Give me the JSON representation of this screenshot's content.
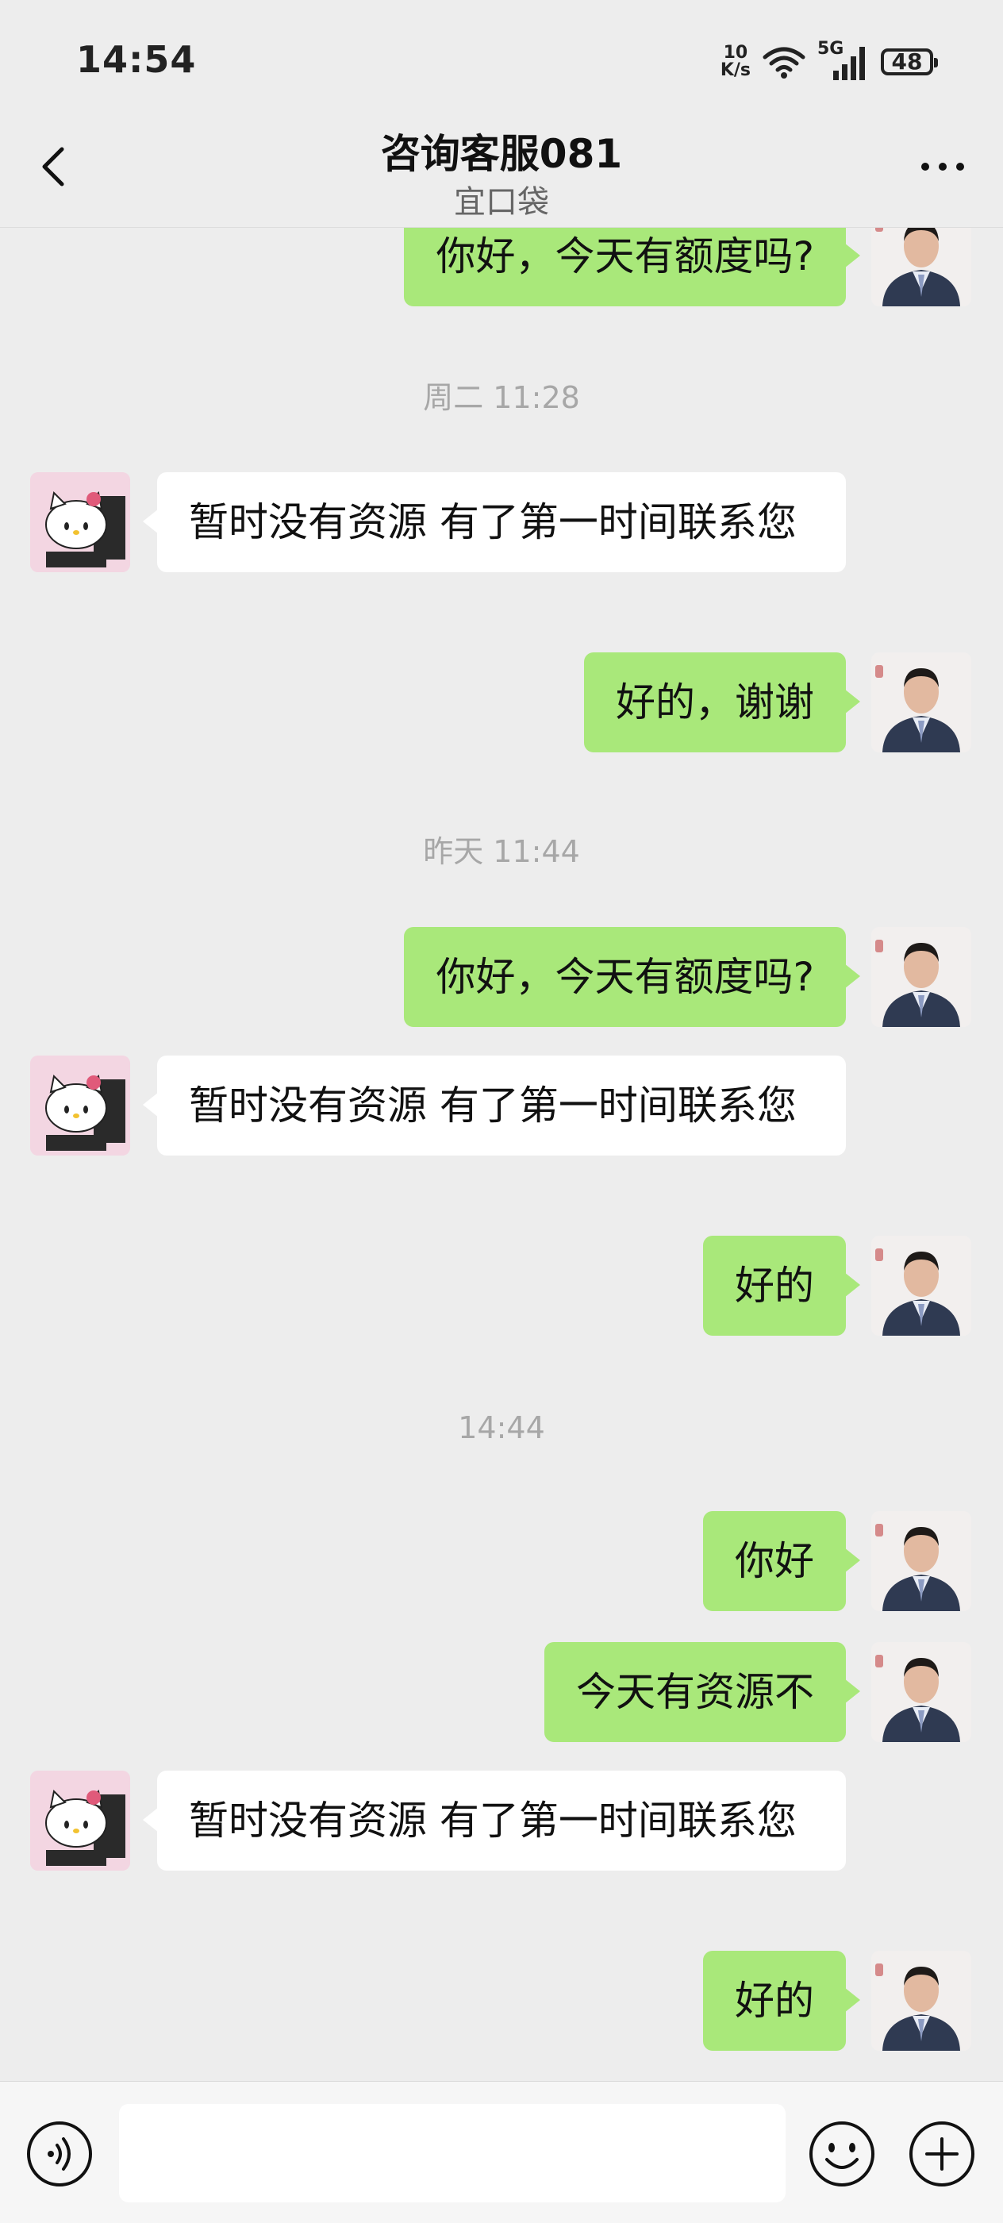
{
  "status_bar": {
    "time": "14:54",
    "net_speed_value": "10",
    "net_speed_unit": "K/s",
    "network_type": "5G",
    "battery": "48"
  },
  "header": {
    "title": "咨询客服081",
    "subtitle": "宜口袋"
  },
  "messages": [
    {
      "type": "sent",
      "text": "你好，今天有额度吗?"
    },
    {
      "type": "time",
      "text": "周二 11:28"
    },
    {
      "type": "received",
      "text": "暂时没有资源  有了第一时间联系您"
    },
    {
      "type": "sent",
      "text": "好的，谢谢"
    },
    {
      "type": "time",
      "text": "昨天 11:44"
    },
    {
      "type": "sent",
      "text": "你好，今天有额度吗?"
    },
    {
      "type": "received",
      "text": "暂时没有资源  有了第一时间联系您"
    },
    {
      "type": "sent",
      "text": "好的"
    },
    {
      "type": "time",
      "text": "14:44"
    },
    {
      "type": "sent",
      "text": "你好"
    },
    {
      "type": "sent",
      "text": "今天有资源不"
    },
    {
      "type": "received",
      "text": "暂时没有资源  有了第一时间联系您"
    },
    {
      "type": "sent",
      "text": "好的"
    }
  ],
  "input": {
    "value": "",
    "placeholder": ""
  },
  "colors": {
    "background": "#ededed",
    "sent_bubble": "#a9e87a",
    "received_bubble": "#ffffff"
  }
}
